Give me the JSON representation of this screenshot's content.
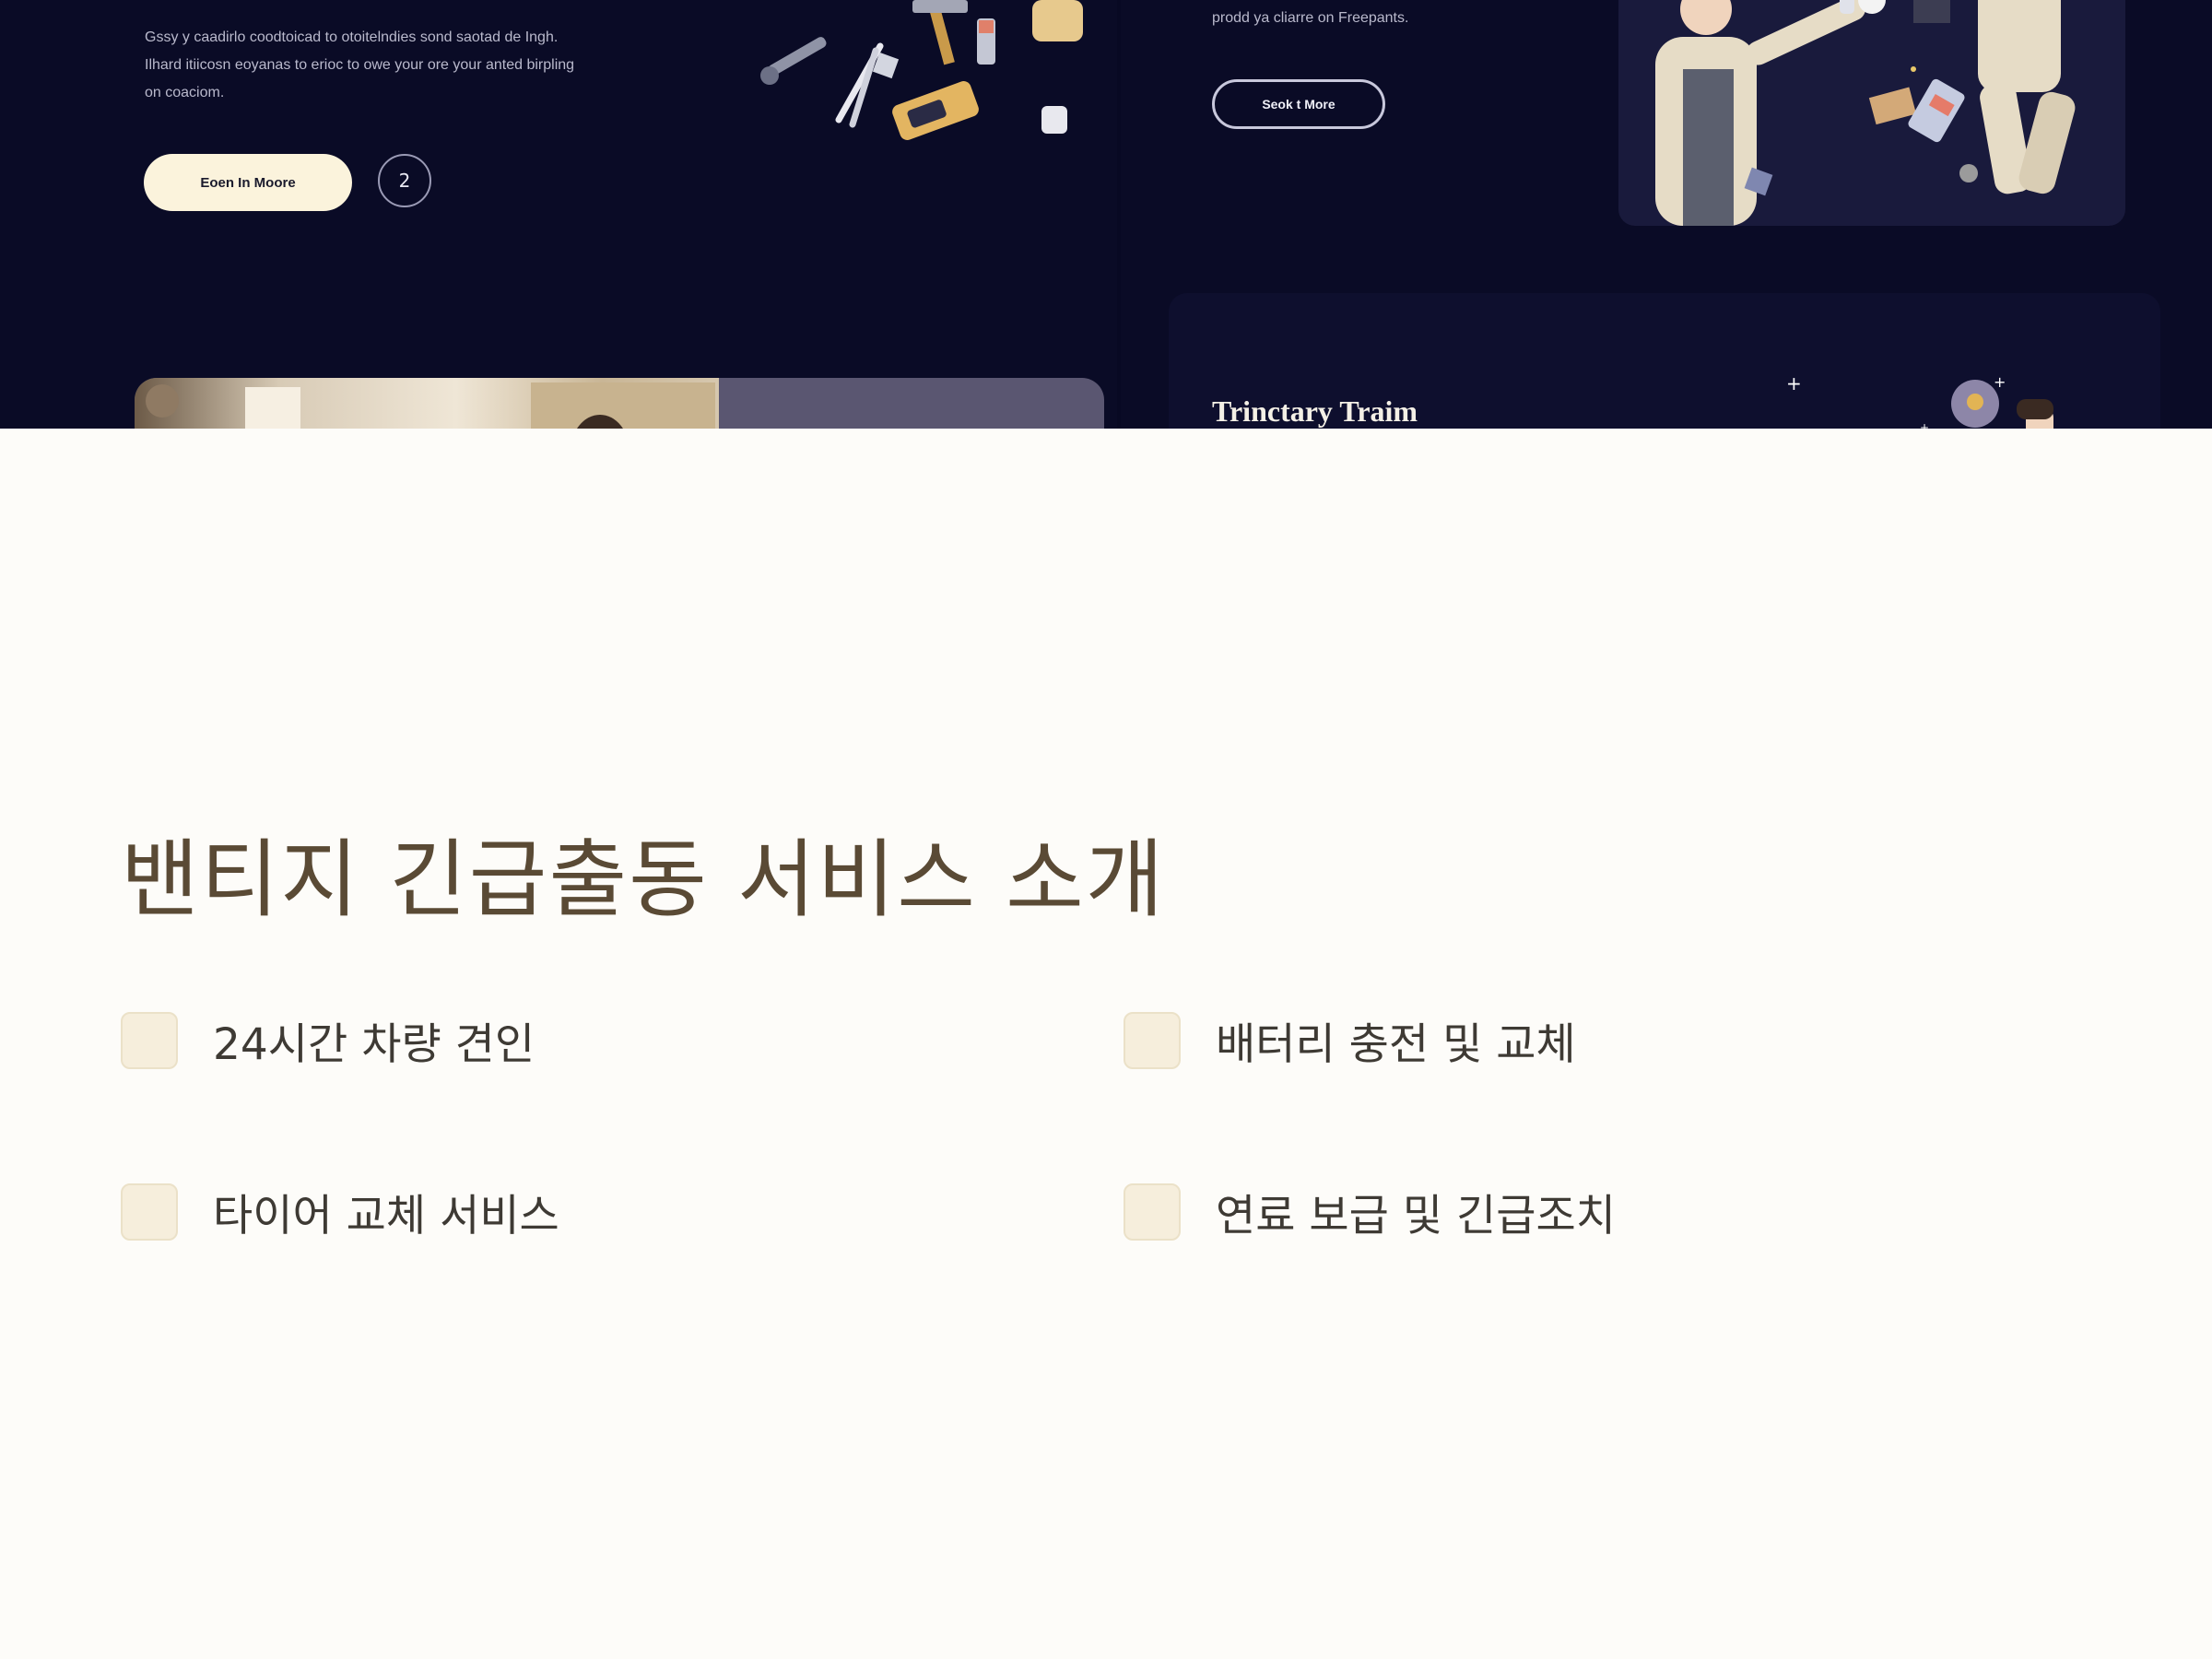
{
  "hero": {
    "left_description": "Gssy y caadirlo coodtoicad to otoitelndies sond saotad de Ingh. Ilhard itiicosn eoyanas to erioc to owe your ore your anted birpling on coaciom.",
    "left_primary_button": "Eoen In Moore",
    "left_circle_button": "2",
    "right_description": "prodd ya cliarre on Freepants.",
    "right_outline_button": "Seok t More",
    "bottom_card_title": "Trinctary Traim"
  },
  "section": {
    "title": "밴티지 긴급출동 서비스 소개",
    "items": [
      {
        "label": "24시간 차량 견인"
      },
      {
        "label": "배터리 충전 및 교체"
      },
      {
        "label": "타이어 교체 서비스"
      },
      {
        "label": "연료 보급 및 긴급조치"
      }
    ]
  },
  "colors": {
    "hero_background": "#0a0b26",
    "page_background": "#fdfcf9",
    "title_color": "#5a4a35",
    "checkbox_fill": "#f6eedc",
    "light_button": "#fbf3dc"
  }
}
